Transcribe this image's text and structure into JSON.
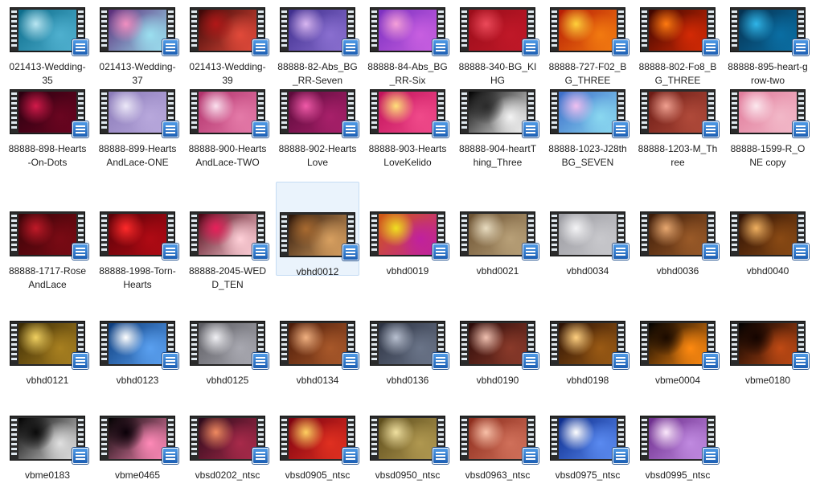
{
  "icons": {
    "file_icon": "video-file-icon",
    "badge_icon": "media-player-badge-icon"
  },
  "colors": {
    "selection_bg": "#eaf3fc",
    "selection_border": "#c5dcf3",
    "badge": "#2f7fd6"
  },
  "files": [
    {
      "name": "021413-Wedding-35",
      "colors": [
        "#0b6b8a",
        "#b9e6f2",
        "#4fb0cf"
      ]
    },
    {
      "name": "021413-Wedding-37",
      "colors": [
        "#5a2a78",
        "#f08fc0",
        "#9be0f0"
      ]
    },
    {
      "name": "021413-Wedding-39",
      "colors": [
        "#3a0606",
        "#b11818",
        "#e24a3a"
      ]
    },
    {
      "name": "88888-82-Abs_BG_RR-Seven",
      "colors": [
        "#3d2d8c",
        "#d8b6f0",
        "#8a6fd0"
      ]
    },
    {
      "name": "88888-84-Abs_BG_RR-Six",
      "colors": [
        "#7a2fc0",
        "#f5a0d8",
        "#c85fe0"
      ]
    },
    {
      "name": "88888-340-BG_KIHG",
      "colors": [
        "#9a0d1a",
        "#ec4a5a",
        "#c01828"
      ]
    },
    {
      "name": "88888-727-F02_BG_THREE",
      "colors": [
        "#b51a05",
        "#ffd13a",
        "#f27a10"
      ]
    },
    {
      "name": "88888-802-Fo8_BG_THREE",
      "colors": [
        "#3a0500",
        "#ff7a10",
        "#d42a05"
      ]
    },
    {
      "name": "88888-895-heart-grow-two",
      "colors": [
        "#05304f",
        "#2fb5e8",
        "#0a6ea3"
      ]
    },
    {
      "name": "88888-898-Hearts-On-Dots",
      "colors": [
        "#2a0010",
        "#d21a4a",
        "#6a0520"
      ]
    },
    {
      "name": "88888-899-HeartsAndLace-ONE",
      "colors": [
        "#8a7ab8",
        "#ece8f8",
        "#b8a8dc"
      ]
    },
    {
      "name": "88888-900-HeartsAndLace-TWO",
      "colors": [
        "#b0306a",
        "#fbe0ee",
        "#e47aa8"
      ]
    },
    {
      "name": "88888-902-HeartsLove",
      "colors": [
        "#5a0a3a",
        "#f05aa8",
        "#a8206a"
      ]
    },
    {
      "name": "88888-903-HeartsLoveKelido",
      "colors": [
        "#c0105a",
        "#ffe07a",
        "#f04a8a"
      ]
    },
    {
      "name": "88888-904-heartThing_Three",
      "colors": [
        "#000000",
        "#2a2a2a",
        "#f4f4f4"
      ]
    },
    {
      "name": "88888-1023-J28thBG_SEVEN",
      "colors": [
        "#3a6ac8",
        "#f0c0f0",
        "#8ad8f0"
      ]
    },
    {
      "name": "88888-1203-M_Three",
      "colors": [
        "#6a1a14",
        "#f0a090",
        "#b04a3a"
      ]
    },
    {
      "name": "88888-1599-R_ONE copy",
      "colors": [
        "#e07a9a",
        "#fce8ee",
        "#f2b8c8"
      ]
    },
    {
      "name": "88888-1717-RoseAndLace",
      "colors": [
        "#3a0408",
        "#c01a28",
        "#7a0a14"
      ]
    },
    {
      "name": "88888-1998-Torn-Hearts",
      "colors": [
        "#5a0208",
        "#ff2a2a",
        "#b00a14"
      ]
    },
    {
      "name": "88888-2045-WEDD_TEN",
      "colors": [
        "#4a0010",
        "#e8205a",
        "#ffd0d8"
      ]
    },
    {
      "name": "vbhd0012",
      "colors": [
        "#2a1408",
        "#a86a30",
        "#d8a060"
      ]
    },
    {
      "name": "vbhd0019",
      "colors": [
        "#d05a10",
        "#f0e020",
        "#c020a0"
      ]
    },
    {
      "name": "vbhd0021",
      "colors": [
        "#6a5030",
        "#e8dcc0",
        "#b8a078"
      ]
    },
    {
      "name": "vbhd0034",
      "colors": [
        "#9a9aa0",
        "#f4f4f6",
        "#c8c8cc"
      ]
    },
    {
      "name": "vbhd0036",
      "colors": [
        "#3a1a08",
        "#e8a870",
        "#9a5a28"
      ]
    },
    {
      "name": "vbhd0040",
      "colors": [
        "#2a0f04",
        "#f0b060",
        "#8a4a14"
      ]
    },
    {
      "name": "vbhd0121",
      "colors": [
        "#3a2a04",
        "#f0d060",
        "#a88020"
      ]
    },
    {
      "name": "vbhd0123",
      "colors": [
        "#0a3a7a",
        "#ffffff",
        "#5aa0f0"
      ]
    },
    {
      "name": "vbhd0125",
      "colors": [
        "#5a5a60",
        "#f0f0f4",
        "#a8a8b0"
      ]
    },
    {
      "name": "vbhd0134",
      "colors": [
        "#4a1a08",
        "#f0b080",
        "#a8582a"
      ]
    },
    {
      "name": "vbhd0136",
      "colors": [
        "#2a3040",
        "#b8c0d0",
        "#6a7488"
      ]
    },
    {
      "name": "vbhd0190",
      "colors": [
        "#2a0a08",
        "#f0c0b0",
        "#8a3a2a"
      ]
    },
    {
      "name": "vbhd0198",
      "colors": [
        "#2a1004",
        "#ffd080",
        "#9a5a14"
      ]
    },
    {
      "name": "vbme0004",
      "colors": [
        "#000000",
        "#1a0a00",
        "#ff8a10"
      ]
    },
    {
      "name": "vbme0180",
      "colors": [
        "#000000",
        "#140400",
        "#c04a14"
      ]
    },
    {
      "name": "vbme0183",
      "colors": [
        "#000000",
        "#0a0a0a",
        "#e0e0e0"
      ]
    },
    {
      "name": "vbme0465",
      "colors": [
        "#000000",
        "#0a0008",
        "#ff8ab8"
      ]
    },
    {
      "name": "vbsd0202_ntsc",
      "colors": [
        "#2a0a1a",
        "#f08a60",
        "#a82a4a"
      ]
    },
    {
      "name": "vbsd0905_ntsc",
      "colors": [
        "#7a0010",
        "#ffd060",
        "#e03020"
      ]
    },
    {
      "name": "vbsd0950_ntsc",
      "colors": [
        "#5a4a1a",
        "#f0e0a0",
        "#b09850"
      ]
    },
    {
      "name": "vbsd0963_ntsc",
      "colors": [
        "#8a2a1a",
        "#f8c0a8",
        "#d0705a"
      ]
    },
    {
      "name": "vbsd0975_ntsc",
      "colors": [
        "#0a2a8a",
        "#ffffff",
        "#5a8af0"
      ]
    },
    {
      "name": "vbsd0995_ntsc",
      "colors": [
        "#6a2a8a",
        "#fbe8fb",
        "#c08ae0"
      ]
    }
  ],
  "selected_name": "vbhd0012"
}
